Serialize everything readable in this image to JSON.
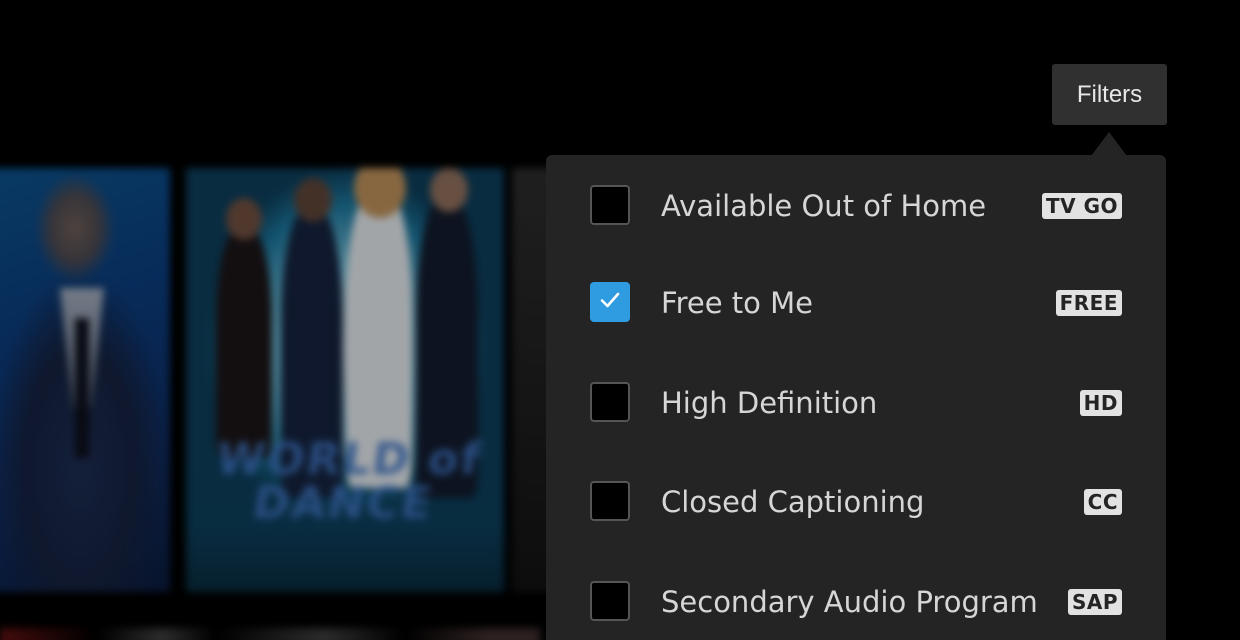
{
  "background": {
    "poster_title": "WORLD of DANCE"
  },
  "filters_button": {
    "label": "Filters"
  },
  "filter_options": [
    {
      "label": "Available Out of Home",
      "badge": "TV GO",
      "checked": false
    },
    {
      "label": "Free to Me",
      "badge": "FREE",
      "checked": true
    },
    {
      "label": "High Definition",
      "badge": "HD",
      "checked": false
    },
    {
      "label": "Closed Captioning",
      "badge": "CC",
      "checked": false
    },
    {
      "label": "Secondary Audio Program",
      "badge": "SAP",
      "checked": false
    }
  ],
  "colors": {
    "panel_background": "#242424",
    "checkbox_checked": "#2f9be0",
    "badge_background": "#e2e2e2",
    "label_text": "#d6d6d6"
  },
  "icons": {
    "checkmark": "check-icon"
  }
}
